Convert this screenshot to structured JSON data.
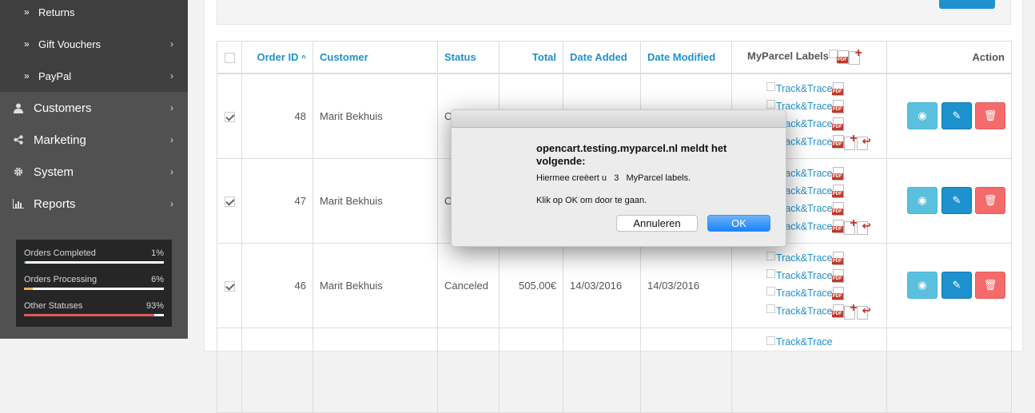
{
  "sidebar": {
    "subitems": [
      {
        "label": "Returns",
        "has_chevron": false
      },
      {
        "label": "Gift Vouchers",
        "has_chevron": true
      },
      {
        "label": "PayPal",
        "has_chevron": true
      }
    ],
    "items": [
      {
        "label": "Customers",
        "icon": "user-icon"
      },
      {
        "label": "Marketing",
        "icon": "share-icon"
      },
      {
        "label": "System",
        "icon": "gear-icon"
      },
      {
        "label": "Reports",
        "icon": "bar-chart-icon"
      }
    ],
    "stats": [
      {
        "label": "Orders Completed",
        "value": "1%",
        "percent": 1,
        "color": "#2fa360"
      },
      {
        "label": "Orders Processing",
        "value": "6%",
        "percent": 6,
        "color": "#f0ad4e"
      },
      {
        "label": "Other Statuses",
        "value": "93%",
        "percent": 93,
        "color": "#e05b5b"
      }
    ]
  },
  "table": {
    "headers": {
      "order_id": "Order ID",
      "customer": "Customer",
      "status": "Status",
      "total": "Total",
      "date_added": "Date Added",
      "date_modified": "Date Modified",
      "myparcel_labels": "MyParcel Labels",
      "action": "Action"
    },
    "track_label": "Track&Trace",
    "rows": [
      {
        "id": "48",
        "customer": "Marit Bekhuis",
        "status": "C",
        "total": "",
        "date_added": "",
        "date_modified": "",
        "checked": true
      },
      {
        "id": "47",
        "customer": "Marit Bekhuis",
        "status": "C",
        "total": "",
        "date_added": "",
        "date_modified": "",
        "checked": true
      },
      {
        "id": "46",
        "customer": "Marit Bekhuis",
        "status": "Canceled",
        "total": "505.00€",
        "date_added": "14/03/2016",
        "date_modified": "14/03/2016",
        "checked": true
      }
    ]
  },
  "dialog": {
    "heading": "opencart.testing.myparcel.nl meldt het volgende:",
    "message1": "Hiermee creëert u   3   MyParcel labels.",
    "message2": "Klik op OK om door te gaan.",
    "cancel": "Annuleren",
    "ok": "OK"
  },
  "colors": {
    "accent": "#1e91cf",
    "sidebar": "#515151",
    "danger": "#f56b6b",
    "info": "#5bc0de"
  }
}
